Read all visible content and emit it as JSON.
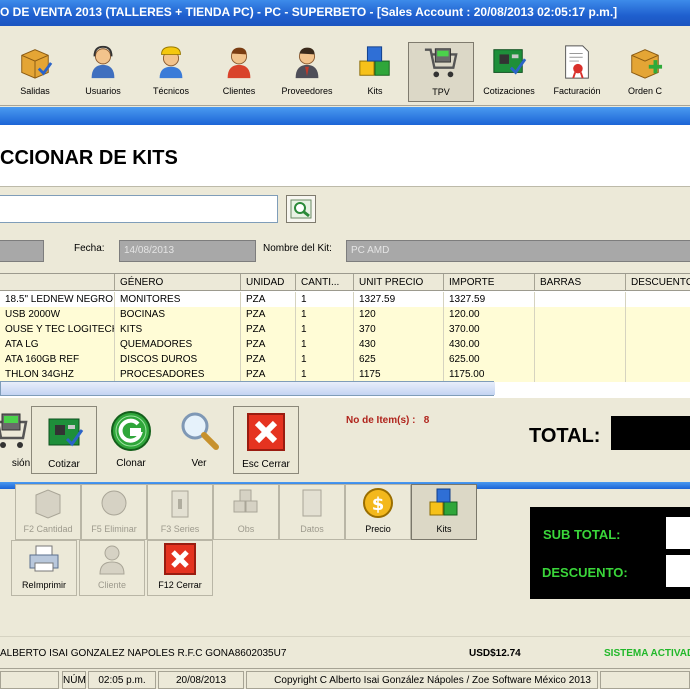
{
  "window": {
    "title": "O DE VENTA 2013   (TALLERES + TIENDA PC)  -  PC  -  SUPERBETO - [Sales Account : 20/08/2013 02:05:17 p.m.]"
  },
  "toolbar": {
    "items": [
      {
        "label": "Salidas",
        "icon": "box-icon"
      },
      {
        "label": "Usuarios",
        "icon": "user-headset-icon"
      },
      {
        "label": "Técnicos",
        "icon": "technician-icon"
      },
      {
        "label": "Clientes",
        "icon": "client-icon"
      },
      {
        "label": "Proveedores",
        "icon": "supplier-icon"
      },
      {
        "label": "Kits",
        "icon": "cubes-icon"
      },
      {
        "label": "TPV",
        "icon": "cart-icon",
        "active": true
      },
      {
        "label": "Cotizaciones",
        "icon": "circuit-board-icon"
      },
      {
        "label": "Facturación",
        "icon": "invoice-icon"
      },
      {
        "label": "Orden C",
        "icon": "order-icon"
      }
    ]
  },
  "page": {
    "title": "CCIONAR DE KITS"
  },
  "form": {
    "fecha_label": "Fecha:",
    "fecha_value": "14/08/2013",
    "nombre_label": "Nombre del Kit:",
    "nombre_value": "PC AMD"
  },
  "grid": {
    "headers": [
      "",
      "GÉNERO",
      "UNIDAD",
      "CANTI...",
      "UNIT PRECIO",
      "IMPORTE",
      "BARRAS",
      "DESCUENTO"
    ],
    "rows": [
      [
        "18.5\" LEDNEW NEGRO",
        "MONITORES",
        "PZA",
        "1",
        "1327.59",
        "1327.59",
        "",
        ""
      ],
      [
        " USB 2000W",
        "BOCINAS",
        "PZA",
        "1",
        "120",
        "120.00",
        "",
        ""
      ],
      [
        "OUSE Y TEC LOGITECH",
        "KITS",
        "PZA",
        "1",
        "370",
        "370.00",
        "",
        ""
      ],
      [
        "ATA LG",
        "QUEMADORES",
        "PZA",
        "1",
        "430",
        "430.00",
        "",
        ""
      ],
      [
        "ATA 160GB REF",
        "DISCOS DUROS",
        "PZA",
        "1",
        "625",
        "625.00",
        "",
        ""
      ],
      [
        "THLON 34GHZ",
        "PROCESADORES",
        "PZA",
        "1",
        "1175",
        "1175.00",
        "",
        ""
      ]
    ]
  },
  "actions": {
    "items": [
      {
        "label": "sión",
        "icon": "cart-icon"
      },
      {
        "label": "Cotizar",
        "icon": "circuit-board-icon"
      },
      {
        "label": "Clonar",
        "icon": "clone-icon"
      },
      {
        "label": "Ver",
        "icon": "magnifier-icon"
      },
      {
        "label": "Esc Cerrar",
        "icon": "close-x-icon"
      }
    ]
  },
  "summary": {
    "items_label": "No de Item(s) :",
    "items_count": "8",
    "total_label": "TOTAL:",
    "subtotal_label": "SUB TOTAL:",
    "descuento_label": "DESCUENTO:"
  },
  "lower": {
    "row1": [
      {
        "label": "F2 Cantidad",
        "disabled": true
      },
      {
        "label": "F5 Eliminar",
        "disabled": true
      },
      {
        "label": "F3 Series",
        "disabled": true
      },
      {
        "label": "Obs",
        "disabled": true
      },
      {
        "label": "Datos",
        "disabled": true
      },
      {
        "label": "Precio",
        "disabled": false
      },
      {
        "label": "Kits",
        "disabled": false,
        "active": true
      }
    ],
    "row2": [
      {
        "label": "ReImprimir",
        "disabled": false
      },
      {
        "label": "Cliente",
        "disabled": true
      },
      {
        "label": "F12 Cerrar",
        "disabled": false
      }
    ]
  },
  "status": {
    "owner": "ALBERTO ISAI GONZALEZ NAPOLES R.F.C GONA8602035U7",
    "usd": "USD$12.74",
    "system": "SISTEMA ACTIVAD",
    "num": "NÚM",
    "time": "02:05 p.m.",
    "date": "20/08/2013",
    "copyright": "Copyright C Alberto Isai González Nápoles / Zoe Software México 2013"
  }
}
